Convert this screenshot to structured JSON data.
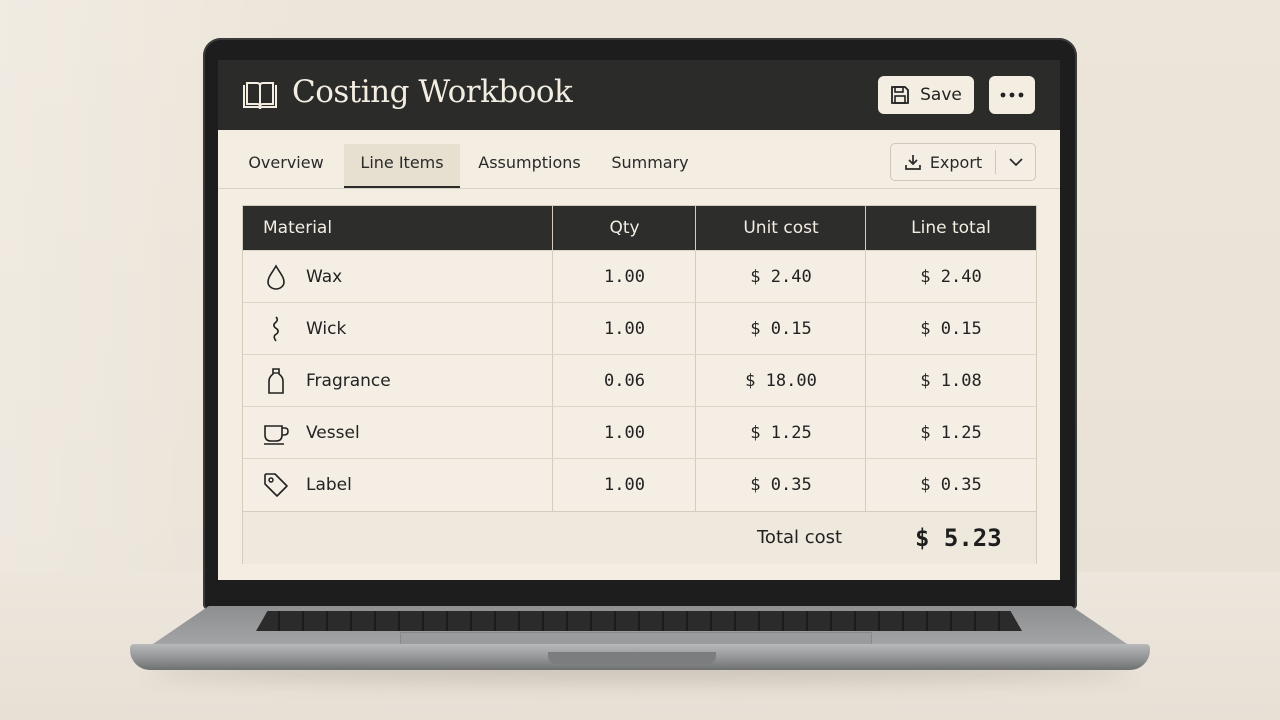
{
  "app": {
    "title": "Costing Workbook"
  },
  "toolbar": {
    "save_label": "Save",
    "more_icon": "more-horizontal-icon"
  },
  "tabs": [
    {
      "label": "Overview",
      "active": false
    },
    {
      "label": "Line Items",
      "active": true
    },
    {
      "label": "Assumptions",
      "active": false
    },
    {
      "label": "Summary",
      "active": false
    }
  ],
  "export": {
    "label": "Export"
  },
  "table": {
    "columns": [
      "Material",
      "Qty",
      "Unit cost",
      "Line total"
    ],
    "rows": [
      {
        "icon": "drop-icon",
        "material": "Wax",
        "qty": "1.00",
        "unit_cost": "$ 2.40",
        "line_total": "$ 2.40"
      },
      {
        "icon": "wick-icon",
        "material": "Wick",
        "qty": "1.00",
        "unit_cost": "$ 0.15",
        "line_total": "$ 0.15"
      },
      {
        "icon": "bottle-icon",
        "material": "Fragrance",
        "qty": "0.06",
        "unit_cost": "$ 18.00",
        "line_total": "$ 1.08"
      },
      {
        "icon": "cup-icon",
        "material": "Vessel",
        "qty": "1.00",
        "unit_cost": "$ 1.25",
        "line_total": "$ 1.25"
      },
      {
        "icon": "tag-icon",
        "material": "Label",
        "qty": "1.00",
        "unit_cost": "$ 0.35",
        "line_total": "$ 0.35"
      }
    ],
    "total_label": "Total cost",
    "total_value": "$ 5.23"
  },
  "colors": {
    "header_bg": "#2b2b2a",
    "screen_bg": "#f3ede2",
    "active_tab_bg": "#e7dfd0"
  }
}
